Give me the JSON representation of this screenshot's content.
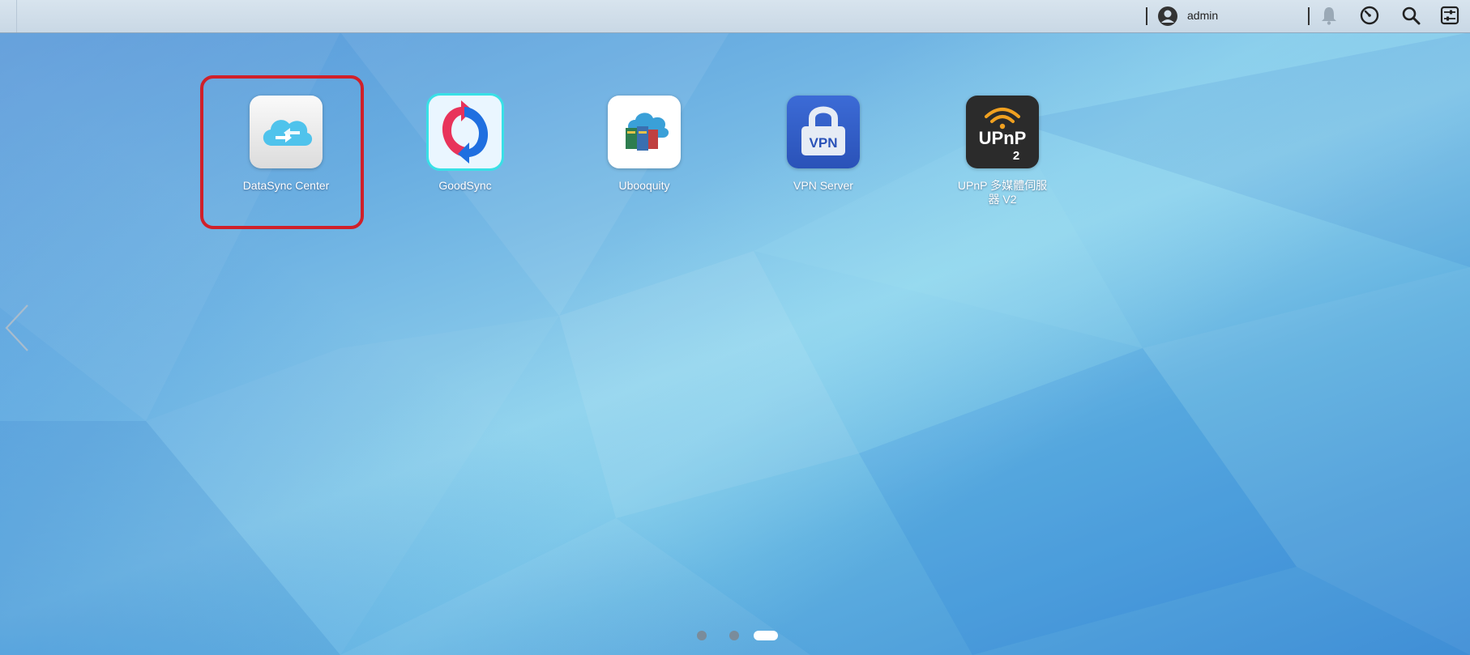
{
  "topbar": {
    "username": "admin",
    "icons": [
      "user-icon",
      "bell-icon",
      "dashboard-icon",
      "search-icon",
      "settings-icon"
    ]
  },
  "apps": [
    {
      "name": "DataSync Center",
      "icon": "datasync-icon",
      "highlighted": true
    },
    {
      "name": "GoodSync",
      "icon": "goodsync-icon"
    },
    {
      "name": "Ubooquity",
      "icon": "ubooquity-icon"
    },
    {
      "name": "VPN Server",
      "icon": "vpn-server-icon",
      "badge": "VPN"
    },
    {
      "name": "UPnP 多媒體伺服器 V2",
      "icon": "upnp-icon",
      "badge": "UPnP",
      "badge_sub": "2"
    }
  ],
  "pagination": {
    "pages": 3,
    "current": 3
  },
  "colors": {
    "highlight": "#d0202a",
    "topbar": "#d8e4ee"
  }
}
